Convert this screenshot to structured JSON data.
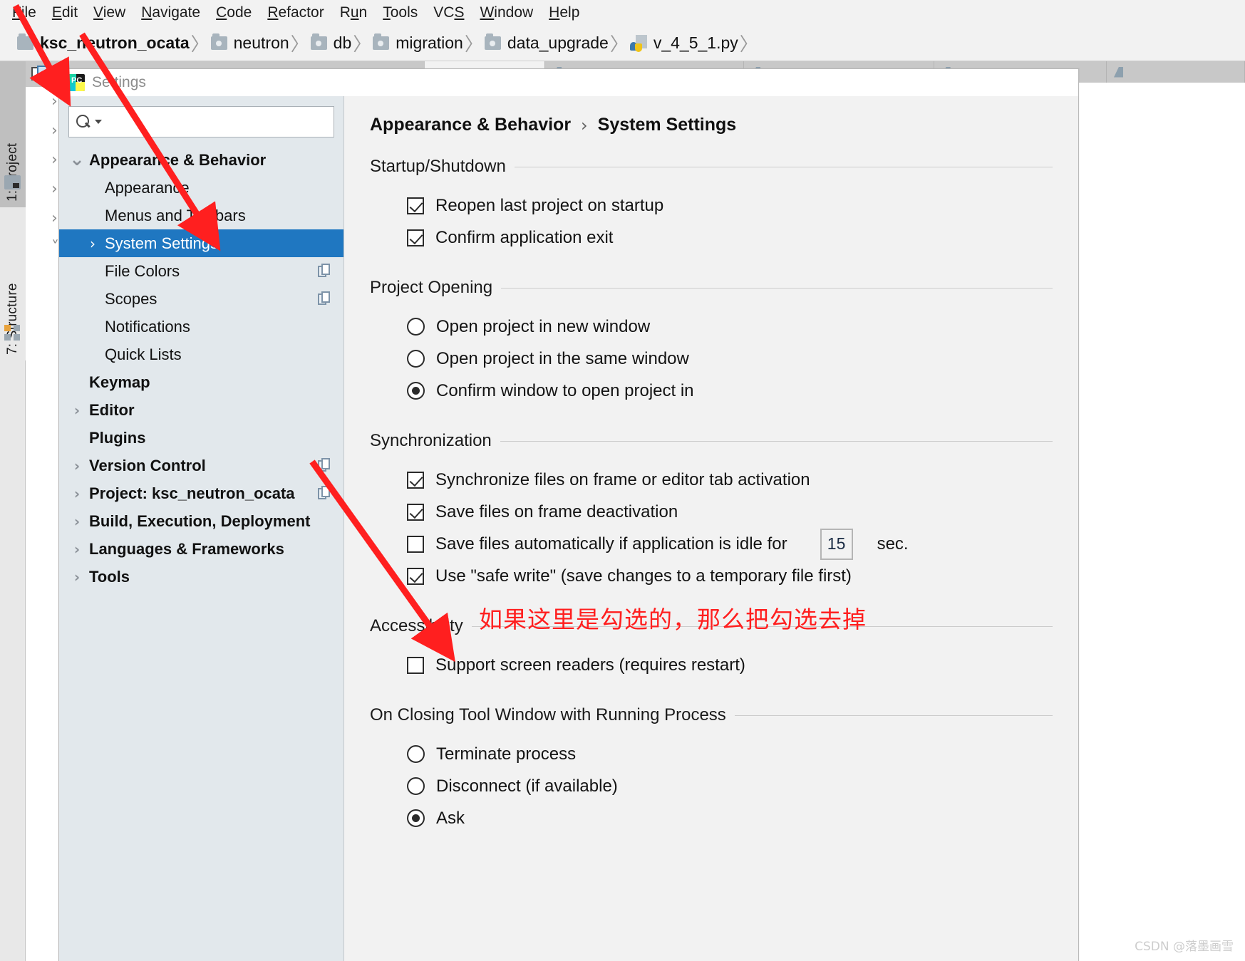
{
  "ide": {
    "menu": [
      {
        "label": "File",
        "mnemonic": "F"
      },
      {
        "label": "Edit",
        "mnemonic": "E"
      },
      {
        "label": "View",
        "mnemonic": "V"
      },
      {
        "label": "Navigate",
        "mnemonic": "N"
      },
      {
        "label": "Code",
        "mnemonic": "C"
      },
      {
        "label": "Refactor",
        "mnemonic": "R"
      },
      {
        "label": "Run",
        "mnemonic": "u"
      },
      {
        "label": "Tools",
        "mnemonic": "T"
      },
      {
        "label": "VCS",
        "mnemonic": "S"
      },
      {
        "label": "Window",
        "mnemonic": "W"
      },
      {
        "label": "Help",
        "mnemonic": "H"
      }
    ],
    "breadcrumb": [
      {
        "label": "ksc_neutron_ocata",
        "icon": "folder-icon",
        "bold": true
      },
      {
        "label": "neutron",
        "icon": "folder-icon",
        "bold": false
      },
      {
        "label": "db",
        "icon": "folder-icon",
        "bold": false
      },
      {
        "label": "migration",
        "icon": "folder-icon",
        "bold": false
      },
      {
        "label": "data_upgrade",
        "icon": "folder-icon",
        "bold": false
      },
      {
        "label": "v_4_5_1.py",
        "icon": "python-file-icon",
        "bold": false
      }
    ],
    "tool_windows": [
      {
        "label": "1: Project",
        "icon": "project-folder-icon",
        "active": true
      },
      {
        "label": "7: Structure",
        "icon": "structure-icon",
        "active": false
      }
    ]
  },
  "dialog": {
    "title": "Settings",
    "icon": "pycharm-icon",
    "search": {
      "value": "",
      "placeholder": "",
      "icon": "search-icon"
    },
    "tree": [
      {
        "label": "Appearance & Behavior",
        "chevron": "down",
        "bold": true,
        "indent": 0,
        "selected": false,
        "copy_icon": false
      },
      {
        "label": "Appearance",
        "chevron": "none",
        "bold": false,
        "indent": 1,
        "selected": false,
        "copy_icon": false
      },
      {
        "label": "Menus and Toolbars",
        "chevron": "none",
        "bold": false,
        "indent": 1,
        "selected": false,
        "copy_icon": false
      },
      {
        "label": "System Settings",
        "chevron": "right",
        "bold": false,
        "indent": 1,
        "selected": true,
        "copy_icon": false
      },
      {
        "label": "File Colors",
        "chevron": "none",
        "bold": false,
        "indent": 1,
        "selected": false,
        "copy_icon": true
      },
      {
        "label": "Scopes",
        "chevron": "none",
        "bold": false,
        "indent": 1,
        "selected": false,
        "copy_icon": true
      },
      {
        "label": "Notifications",
        "chevron": "none",
        "bold": false,
        "indent": 1,
        "selected": false,
        "copy_icon": false
      },
      {
        "label": "Quick Lists",
        "chevron": "none",
        "bold": false,
        "indent": 1,
        "selected": false,
        "copy_icon": false
      },
      {
        "label": "Keymap",
        "chevron": "none",
        "bold": true,
        "indent": 0,
        "selected": false,
        "copy_icon": false
      },
      {
        "label": "Editor",
        "chevron": "right",
        "bold": true,
        "indent": 0,
        "selected": false,
        "copy_icon": false
      },
      {
        "label": "Plugins",
        "chevron": "none",
        "bold": true,
        "indent": 0,
        "selected": false,
        "copy_icon": false
      },
      {
        "label": "Version Control",
        "chevron": "right",
        "bold": true,
        "indent": 0,
        "selected": false,
        "copy_icon": true
      },
      {
        "label": "Project: ksc_neutron_ocata",
        "chevron": "right",
        "bold": true,
        "indent": 0,
        "selected": false,
        "copy_icon": true
      },
      {
        "label": "Build, Execution, Deployment",
        "chevron": "right",
        "bold": true,
        "indent": 0,
        "selected": false,
        "copy_icon": false
      },
      {
        "label": "Languages & Frameworks",
        "chevron": "right",
        "bold": true,
        "indent": 0,
        "selected": false,
        "copy_icon": false
      },
      {
        "label": "Tools",
        "chevron": "right",
        "bold": true,
        "indent": 0,
        "selected": false,
        "copy_icon": false
      }
    ],
    "breadcrumb": {
      "parent": "Appearance & Behavior",
      "separator": "›",
      "current": "System Settings"
    },
    "sections": [
      {
        "title": "Startup/Shutdown",
        "options": [
          {
            "type": "checkbox",
            "label": "Reopen last project on startup",
            "checked": true
          },
          {
            "type": "checkbox",
            "label": "Confirm application exit",
            "checked": true
          }
        ]
      },
      {
        "title": "Project Opening",
        "options": [
          {
            "type": "radio",
            "label": "Open project in new window",
            "checked": false
          },
          {
            "type": "radio",
            "label": "Open project in the same window",
            "checked": false
          },
          {
            "type": "radio",
            "label": "Confirm window to open project in",
            "checked": true
          }
        ]
      },
      {
        "title": "Synchronization",
        "options": [
          {
            "type": "checkbox",
            "label": "Synchronize files on frame or editor tab activation",
            "checked": true
          },
          {
            "type": "checkbox",
            "label": "Save files on frame deactivation",
            "checked": true
          },
          {
            "type": "checkbox",
            "label": "Save files automatically if application is idle for",
            "checked": false,
            "spinner_value": "15",
            "suffix": "sec."
          },
          {
            "type": "checkbox",
            "label": "Use \"safe write\" (save changes to a temporary file first)",
            "checked": true
          }
        ]
      },
      {
        "title": "Accessibility",
        "options": [
          {
            "type": "checkbox",
            "label": "Support screen readers (requires restart)",
            "checked": false
          }
        ]
      },
      {
        "title": "On Closing Tool Window with Running Process",
        "options": [
          {
            "type": "radio",
            "label": "Terminate process",
            "checked": false
          },
          {
            "type": "radio",
            "label": "Disconnect (if available)",
            "checked": false
          },
          {
            "type": "radio",
            "label": "Ask",
            "checked": true
          }
        ]
      }
    ]
  },
  "annotations": {
    "note_text": "如果这里是勾选的，那么把勾选去掉",
    "color": "#ff1f1f",
    "arrows": 3
  },
  "watermark": "CSDN @落墨画雪"
}
